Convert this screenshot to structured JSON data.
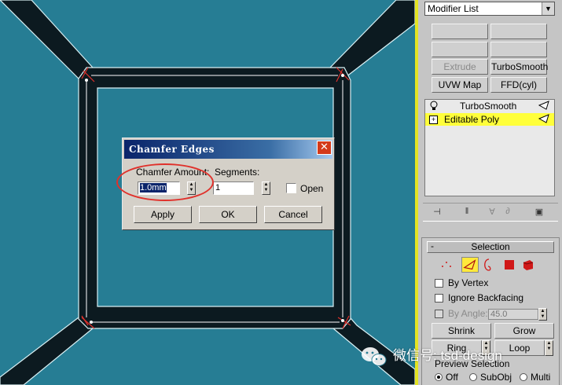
{
  "dialog": {
    "title": "Chamfer Edges",
    "chamfer_amount_label": "Chamfer Amount:",
    "chamfer_amount_value": "1.0mm",
    "segments_label": "Segments:",
    "segments_value": "1",
    "open_label": "Open",
    "apply_label": "Apply",
    "ok_label": "OK",
    "cancel_label": "Cancel"
  },
  "command_panel": {
    "modifier_list": "Modifier List",
    "buttons": {
      "extrude": "Extrude",
      "turbosmooth": "TurboSmooth",
      "uvw_map": "UVW Map",
      "ffd": "FFD(cyl)"
    },
    "stack": [
      {
        "label": "TurboSmooth",
        "icon": "lightbulb-icon"
      },
      {
        "label": "Editable Poly",
        "icon": "plus-icon",
        "selected": true
      }
    ]
  },
  "selection_rollout": {
    "title": "Selection",
    "minus": "-",
    "by_vertex": "By Vertex",
    "ignore_backfacing": "Ignore Backfacing",
    "by_angle": "By Angle:",
    "by_angle_value": "45.0",
    "shrink": "Shrink",
    "grow": "Grow",
    "ring": "Ring",
    "loop": "Loop",
    "preview_selection": "Preview Selection",
    "preview_off": "Off",
    "preview_subobj": "SubObj",
    "preview_multi": "Multi"
  },
  "watermark": "微信号: tsd-design",
  "colors": {
    "viewport": "#267d94",
    "dialog_title": "#0a246a",
    "highlight": "#ffff3a",
    "annotation": "#e0312b"
  }
}
